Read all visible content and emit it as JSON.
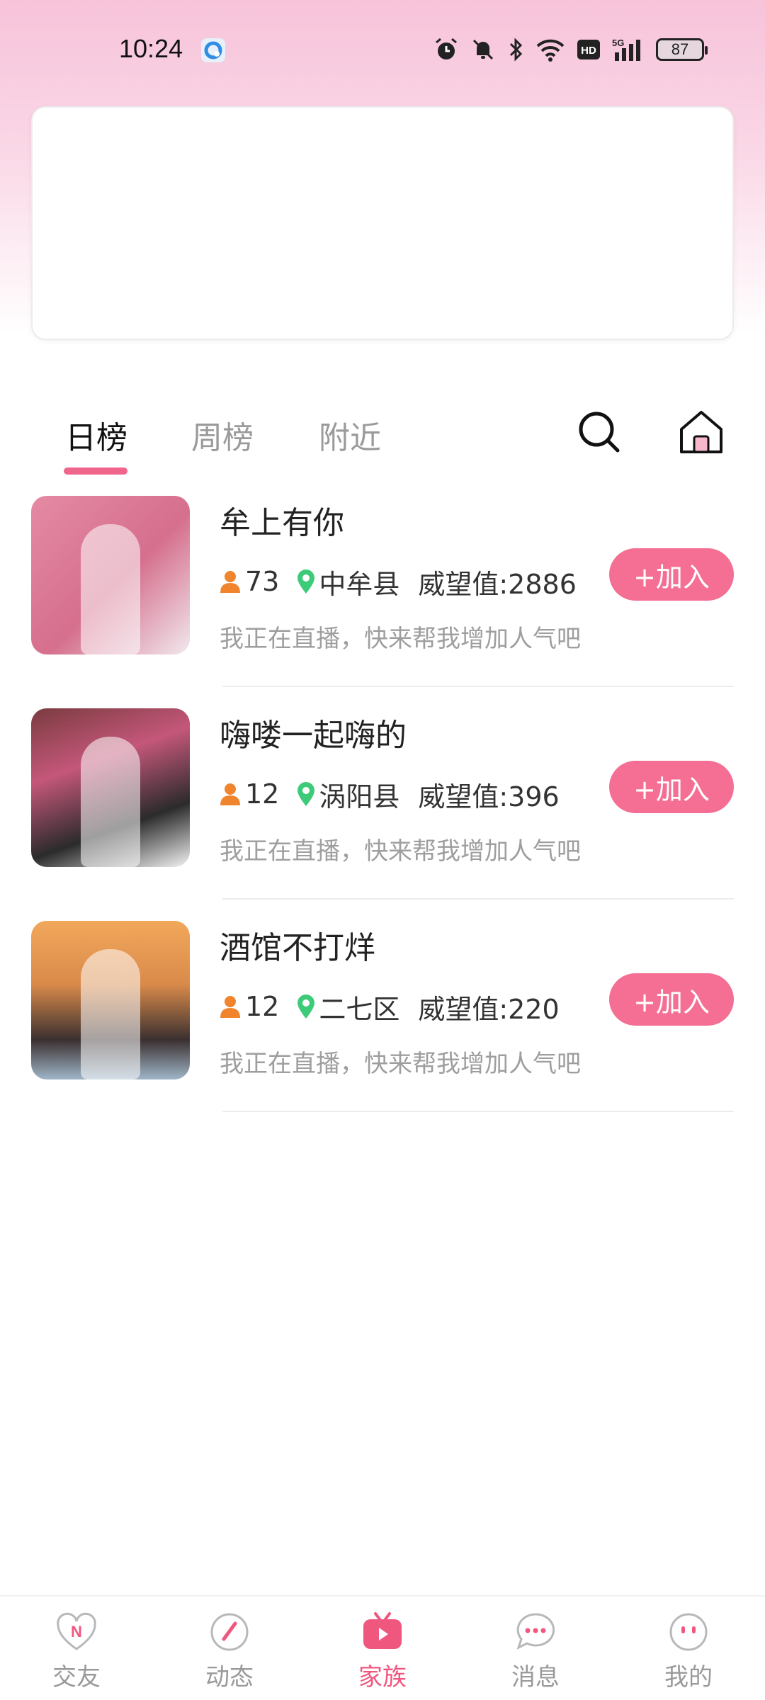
{
  "status_bar": {
    "time": "10:24",
    "battery": "87"
  },
  "tabs": [
    {
      "label": "日榜",
      "active": true
    },
    {
      "label": "周榜",
      "active": false
    },
    {
      "label": "附近",
      "active": false
    }
  ],
  "tab_actions": {
    "search_icon": "search-icon",
    "home_icon": "home-icon"
  },
  "families": [
    {
      "name": "牟上有你",
      "members": "73",
      "location": "中牟县",
      "prestige": "威望值:2886",
      "description": "我正在直播，快来帮我增加人气吧",
      "join_label": "+加入"
    },
    {
      "name": "嗨喽一起嗨的",
      "members": "12",
      "location": "涡阳县",
      "prestige": "威望值:396",
      "description": "我正在直播，快来帮我增加人气吧",
      "join_label": "+加入"
    },
    {
      "name": "酒馆不打烊",
      "members": "12",
      "location": "二七区",
      "prestige": "威望值:220",
      "description": "我正在直播，快来帮我增加人气吧",
      "join_label": "+加入"
    }
  ],
  "bottom_nav": [
    {
      "label": "交友",
      "icon": "heart-n-icon",
      "active": false
    },
    {
      "label": "动态",
      "icon": "compass-icon",
      "active": false
    },
    {
      "label": "家族",
      "icon": "tv-play-icon",
      "active": true
    },
    {
      "label": "消息",
      "icon": "chat-bubble-icon",
      "active": false
    },
    {
      "label": "我的",
      "icon": "face-icon",
      "active": false
    }
  ],
  "colors": {
    "accent": "#f46f93",
    "active_nav": "#f0577f",
    "member_icon": "#f0852d",
    "location_icon": "#3dcb7a"
  }
}
